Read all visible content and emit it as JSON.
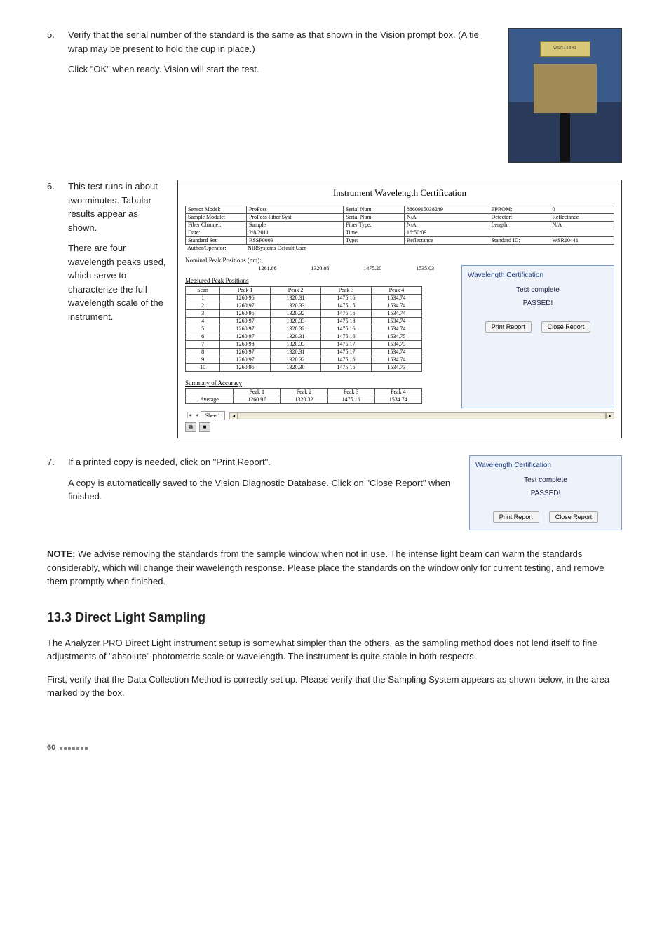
{
  "items": {
    "5": {
      "num": "5.",
      "p1": "Verify that the serial number of the standard is the same as that shown in the Vision prompt box. (A tie wrap may be present to hold the cup in place.)",
      "p2": "Click \"OK\" when ready. Vision will start the test.",
      "photo_label": "WSR10841"
    },
    "6": {
      "num": "6.",
      "p1": "This test runs in about two minutes. Tabular results appear as shown.",
      "p2": "There are four wavelength peaks used, which serve to characterize the full wavelength scale of the instrument."
    },
    "7": {
      "num": "7.",
      "p1": "If a printed copy is needed, click on \"Print Report\".",
      "p2": "A copy is automatically saved to the Vision Diagnostic Database. Click on \"Close Report\" when finished."
    }
  },
  "report": {
    "title": "Instrument Wavelength Certification",
    "info": [
      [
        "Sensor Model:",
        "ProFoss",
        "Serial Num:",
        "8860915038249",
        "EPROM:",
        "0"
      ],
      [
        "Sample Module:",
        "ProFoss Fiber Syst",
        "Serial Num:",
        "N/A",
        "Detector:",
        "Reflectance"
      ],
      [
        "Fiber Channel:",
        "Sample",
        "Fiber Type:",
        "N/A",
        "Length:",
        "N/A"
      ],
      [
        "Date:",
        "2/8/2011",
        "Time:",
        "16:50:09",
        "",
        ""
      ],
      [
        "Standard Set:",
        "RSSP0009",
        "Type:",
        "Reflectance",
        "Standard ID:",
        "WSR10441"
      ]
    ],
    "author_label": "Author/Operator:",
    "author_value": "NIRSystems Default User",
    "nominal_label": "Nominal Peak Positions (nm):",
    "nominal": [
      "1261.86",
      "1320.86",
      "1475.20",
      "1535.03"
    ],
    "measured_label": "Measured Peak Positions",
    "measured_head": [
      "Scan",
      "Peak 1",
      "Peak 2",
      "Peak 3",
      "Peak 4"
    ],
    "measured": [
      [
        "1",
        "1260.96",
        "1320.31",
        "1475.16",
        "1534.74"
      ],
      [
        "2",
        "1260.97",
        "1320.33",
        "1475.15",
        "1534.74"
      ],
      [
        "3",
        "1260.95",
        "1320.32",
        "1475.16",
        "1534.74"
      ],
      [
        "4",
        "1260.97",
        "1320.33",
        "1475.18",
        "1534.74"
      ],
      [
        "5",
        "1260.97",
        "1320.32",
        "1475.16",
        "1534.74"
      ],
      [
        "6",
        "1260.97",
        "1320.31",
        "1475.16",
        "1534.75"
      ],
      [
        "7",
        "1260.98",
        "1320.33",
        "1475.17",
        "1534.73"
      ],
      [
        "8",
        "1260.97",
        "1320.31",
        "1475.17",
        "1534.74"
      ],
      [
        "9",
        "1260.97",
        "1320.32",
        "1475.16",
        "1534.74"
      ],
      [
        "10",
        "1260.95",
        "1320.30",
        "1475.15",
        "1534.73"
      ]
    ],
    "summary_label": "Summary of Accuracy",
    "summary_head": [
      "",
      "Peak 1",
      "Peak 2",
      "Peak 3",
      "Peak 4"
    ],
    "summary_row": [
      "Average",
      "1260.97",
      "1320.32",
      "1475.16",
      "1534.74"
    ],
    "sheet_tab": "Sheet1"
  },
  "dialog": {
    "title": "Wavelength Certification",
    "line1": "Test complete",
    "line2": "PASSED!",
    "print": "Print Report",
    "close": "Close Report"
  },
  "note": {
    "label": "NOTE:",
    "text": " We advise removing the standards from the sample window when not in use. The intense light beam can warm the standards considerably, which will change their wavelength response. Please place the standards on the window only for current testing, and remove them promptly when finished."
  },
  "section": {
    "heading": "13.3 Direct Light Sampling",
    "p1": "The Analyzer PRO Direct Light instrument setup is somewhat simpler than the others, as the sampling method does not lend itself to fine adjustments of \"absolute\" photometric scale or wavelength. The instrument is quite stable in both respects.",
    "p2": "First, verify that the Data Collection Method is correctly set up. Please verify that the Sampling System appears as shown below, in the area marked by the box."
  },
  "footer": {
    "page": "60"
  },
  "chart_data": {
    "type": "table",
    "title": "Instrument Wavelength Certification — Measured Peak Positions",
    "columns": [
      "Scan",
      "Peak 1 (nm)",
      "Peak 2 (nm)",
      "Peak 3 (nm)",
      "Peak 4 (nm)"
    ],
    "rows": [
      [
        1,
        1260.96,
        1320.31,
        1475.16,
        1534.74
      ],
      [
        2,
        1260.97,
        1320.33,
        1475.15,
        1534.74
      ],
      [
        3,
        1260.95,
        1320.32,
        1475.16,
        1534.74
      ],
      [
        4,
        1260.97,
        1320.33,
        1475.18,
        1534.74
      ],
      [
        5,
        1260.97,
        1320.32,
        1475.16,
        1534.74
      ],
      [
        6,
        1260.97,
        1320.31,
        1475.16,
        1534.75
      ],
      [
        7,
        1260.98,
        1320.33,
        1475.17,
        1534.73
      ],
      [
        8,
        1260.97,
        1320.31,
        1475.17,
        1534.74
      ],
      [
        9,
        1260.97,
        1320.32,
        1475.16,
        1534.74
      ],
      [
        10,
        1260.95,
        1320.3,
        1475.15,
        1534.73
      ]
    ],
    "nominal_peaks_nm": [
      1261.86,
      1320.86,
      1475.2,
      1535.03
    ],
    "summary_average_nm": [
      1260.97,
      1320.32,
      1475.16,
      1534.74
    ]
  }
}
